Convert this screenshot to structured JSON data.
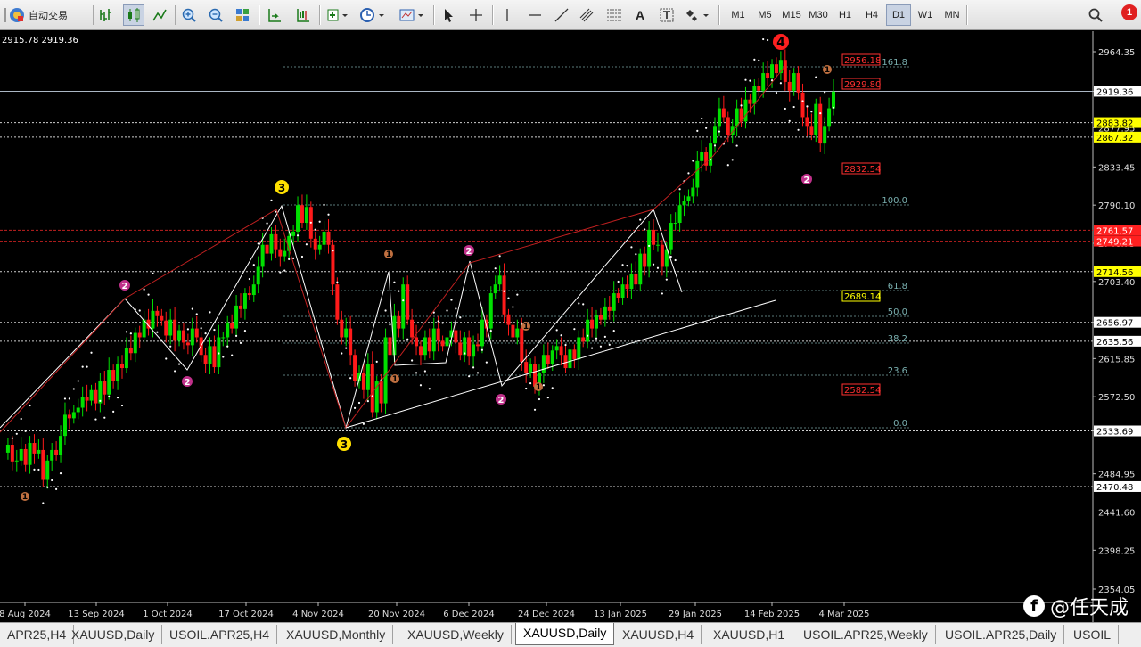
{
  "toolbar": {
    "auto_trade_label": "自动交易",
    "timeframes": [
      {
        "label": "M1",
        "active": false
      },
      {
        "label": "M5",
        "active": false
      },
      {
        "label": "M15",
        "active": false
      },
      {
        "label": "M30",
        "active": false
      },
      {
        "label": "H1",
        "active": false
      },
      {
        "label": "H4",
        "active": false
      },
      {
        "label": "D1",
        "active": true
      },
      {
        "label": "W1",
        "active": false
      },
      {
        "label": "MN",
        "active": false
      }
    ],
    "tools": [
      "new-chart",
      "bar-chart",
      "candlestick",
      "line-chart",
      "zoom-in",
      "zoom-out",
      "tile-windows",
      "auto-scroll",
      "chart-shift",
      "indicators",
      "periods",
      "templates",
      "cursor",
      "crosshair",
      "vertical-line",
      "horizontal-line",
      "trendline",
      "equidistant-channel",
      "fibonacci",
      "text",
      "text-label",
      "arrows"
    ],
    "notification_badge": "1"
  },
  "chart": {
    "header_text": "2915.78 2919.36",
    "y_ticks": [
      "2964.35",
      "2919.36",
      "2877.95",
      "2833.45",
      "2790.10",
      "2746.75",
      "2703.40",
      "2656.97",
      "2615.85",
      "2572.50",
      "2533.69",
      "2484.95",
      "2441.60",
      "2398.25",
      "2354.05"
    ],
    "x_ticks": [
      "8 Aug 2024",
      "13 Sep 2024",
      "1 Oct 2024",
      "17 Oct 2024",
      "4 Nov 2024",
      "20 Nov 2024",
      "6 Dec 2024",
      "24 Dec 2024",
      "13 Jan 2025",
      "29 Jan 2025",
      "14 Feb 2025",
      "4 Mar 2025"
    ],
    "current_price": "2919.36",
    "price_labels": [
      {
        "text": "2883.82",
        "color": "#ffff00"
      },
      {
        "text": "2867.32",
        "color": "#ffff00"
      },
      {
        "text": "2761.57",
        "color": "#ff2020"
      },
      {
        "text": "2749.21",
        "color": "#ff2020"
      },
      {
        "text": "2714.56",
        "color": "#ffff00"
      },
      {
        "text": "2656.97",
        "color": "#ffffff"
      },
      {
        "text": "2635.56",
        "color": "#ffffff"
      },
      {
        "text": "2533.69",
        "color": "#ffffff"
      },
      {
        "text": "2470.48",
        "color": "#ffffff"
      }
    ],
    "boxed_labels": [
      {
        "text": "2956.18",
        "color": "#ff3030"
      },
      {
        "text": "2929.80",
        "color": "#ff3030"
      },
      {
        "text": "2832.54",
        "color": "#ff3030"
      },
      {
        "text": "2689.14",
        "color": "#ffff00"
      },
      {
        "text": "2582.54",
        "color": "#ff3030"
      }
    ],
    "fib_levels": [
      "161.8",
      "100.0",
      "61.8",
      "50.0",
      "38.2",
      "23.6",
      "0.0"
    ],
    "wave_markers": [
      {
        "label": "4",
        "kind": "red"
      },
      {
        "label": "3",
        "kind": "yellow"
      },
      {
        "label": "3",
        "kind": "yellow"
      },
      {
        "label": "2",
        "kind": "magenta"
      },
      {
        "label": "2",
        "kind": "magenta"
      },
      {
        "label": "2",
        "kind": "magenta"
      },
      {
        "label": "2",
        "kind": "magenta"
      },
      {
        "label": "2",
        "kind": "magenta"
      },
      {
        "label": "1",
        "kind": "brown"
      },
      {
        "label": "1",
        "kind": "brown"
      },
      {
        "label": "1",
        "kind": "brown"
      },
      {
        "label": "1",
        "kind": "brown"
      },
      {
        "label": "1",
        "kind": "brown"
      },
      {
        "label": "1",
        "kind": "brown"
      }
    ],
    "colors": {
      "bull": "#00e000",
      "bear": "#ff1a1a",
      "grid": "#4a4a4a"
    }
  },
  "tabs": [
    {
      "label": "APR25,H4",
      "active": false
    },
    {
      "label": "XAUUSD,Daily",
      "active": false
    },
    {
      "label": "USOIL.APR25,H4",
      "active": false
    },
    {
      "label": "XAUUSD,Monthly",
      "active": false
    },
    {
      "label": "XAUUSD,Weekly",
      "active": false
    },
    {
      "label": "XAUUSD,Daily",
      "active": true
    },
    {
      "label": "XAUUSD,H4",
      "active": false
    },
    {
      "label": "XAUUSD,H1",
      "active": false
    },
    {
      "label": "USOIL.APR25,Weekly",
      "active": false
    },
    {
      "label": "USOIL.APR25,Daily",
      "active": false
    },
    {
      "label": "USOIL",
      "active": false
    }
  ],
  "watermark": {
    "logo": "f",
    "text": "@任天成"
  }
}
